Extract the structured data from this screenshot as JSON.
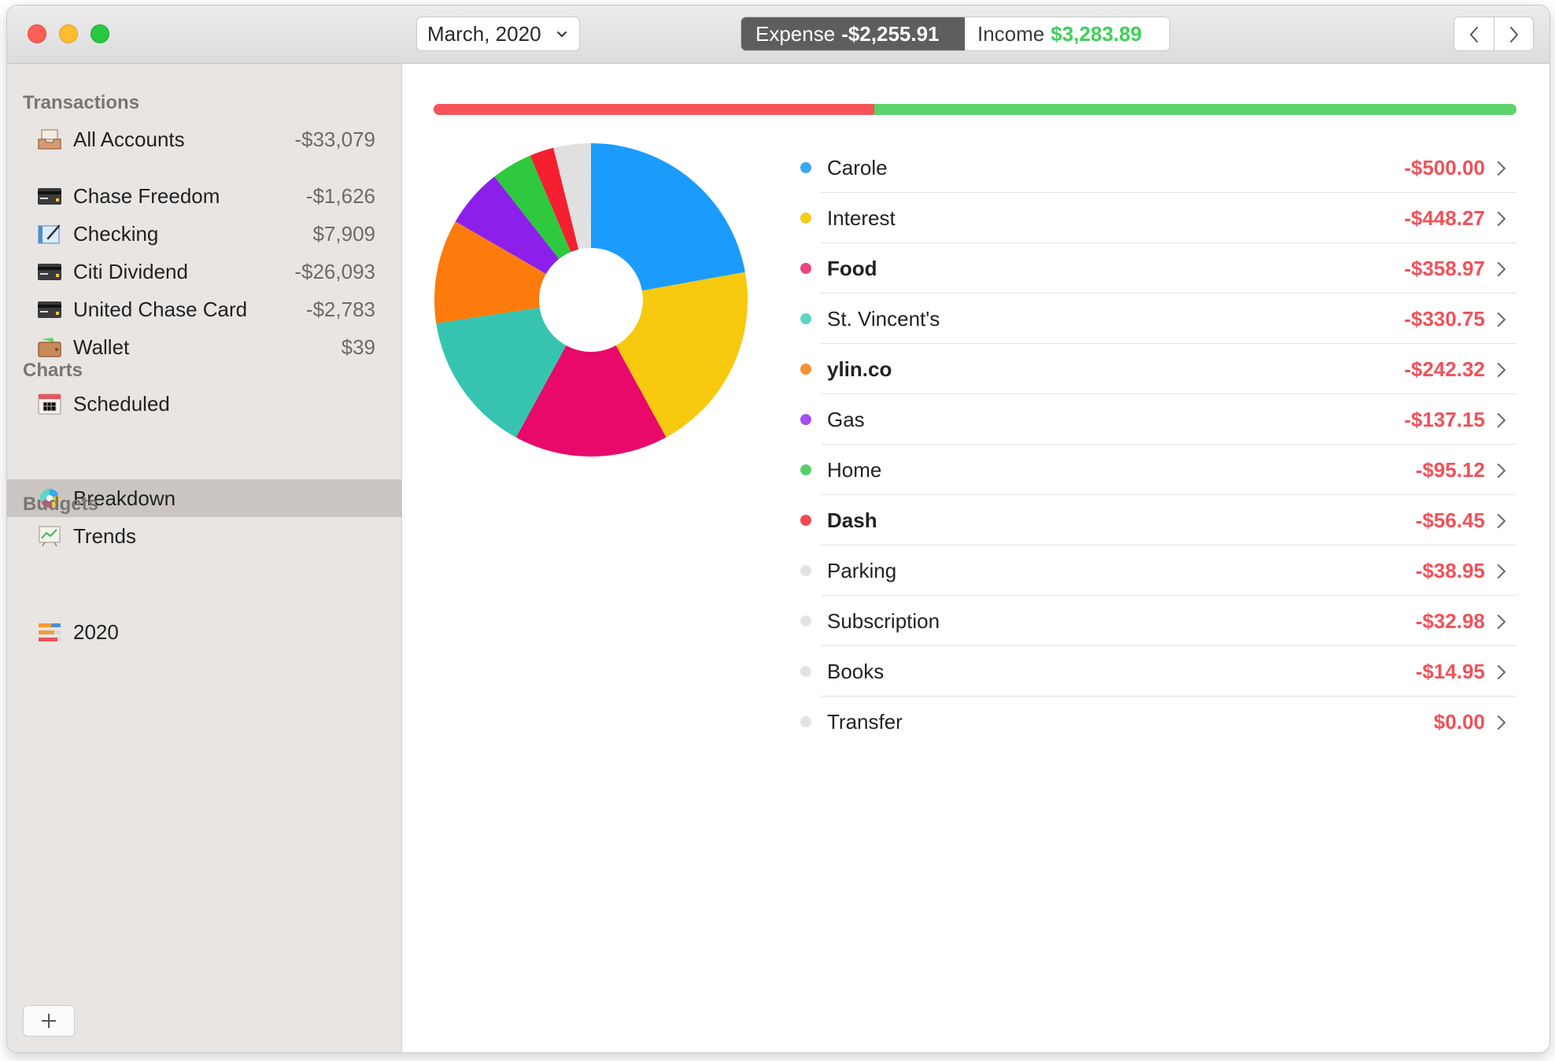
{
  "toolbar": {
    "month": "March, 2020",
    "expense_label": "Expense",
    "expense_value": "-$2,255.91",
    "income_label": "Income",
    "income_value": "$3,283.89"
  },
  "sidebar": {
    "transactions_header": "Transactions",
    "all_accounts": {
      "label": "All Accounts",
      "amount": "-$33,079",
      "icon": "inbox-tray-icon"
    },
    "accounts": [
      {
        "label": "Chase Freedom",
        "amount": "-$1,626",
        "icon": "credit-card-icon"
      },
      {
        "label": "Checking",
        "amount": "$7,909",
        "icon": "checkbook-icon"
      },
      {
        "label": "Citi Dividend",
        "amount": "-$26,093",
        "icon": "credit-card-icon"
      },
      {
        "label": "United Chase Card",
        "amount": "-$2,783",
        "icon": "credit-card-icon"
      },
      {
        "label": "Wallet",
        "amount": "$39",
        "icon": "wallet-icon"
      }
    ],
    "scheduled": {
      "label": "Scheduled",
      "icon": "calendar-icon"
    },
    "charts_header": "Charts",
    "charts": [
      {
        "label": "Breakdown",
        "icon": "pie-chart-icon",
        "selected": true
      },
      {
        "label": "Trends",
        "icon": "line-chart-icon",
        "selected": false
      }
    ],
    "budgets_header": "Budgets",
    "budgets": [
      {
        "label": "2020",
        "icon": "budget-bars-icon"
      }
    ],
    "add_icon": "plus-icon"
  },
  "colors": {
    "expense": "#f55359",
    "income": "#5ed36b",
    "selected_row": "#cbc6c3"
  },
  "ratio": {
    "expense_fraction": 0.407
  },
  "chart_data": {
    "type": "pie",
    "donut": true,
    "categories": [
      "Carole",
      "Interest",
      "Food",
      "St. Vincent's",
      "ylin.co",
      "Gas",
      "Home",
      "Dash",
      "Parking",
      "Subscription",
      "Books",
      "Transfer"
    ],
    "values": [
      500.0,
      448.27,
      358.97,
      330.75,
      242.32,
      137.15,
      95.12,
      56.45,
      38.95,
      32.98,
      14.95,
      0.0
    ],
    "display_values": [
      "-$500.00",
      "-$448.27",
      "-$358.97",
      "-$330.75",
      "-$242.32",
      "-$137.15",
      "-$95.12",
      "-$56.45",
      "-$38.95",
      "-$32.98",
      "-$14.95",
      "$0.00"
    ],
    "slice_colors": [
      "#1b9cfc",
      "#f7c90f",
      "#e8096a",
      "#36c4b0",
      "#fd7a0d",
      "#8c20ea",
      "#2ec93e",
      "#f51f2f",
      "#e0e0e0",
      "#e0e0e0",
      "#e0e0e0",
      "#e0e0e0"
    ],
    "legend_colors": [
      "#3aa6f5",
      "#f5cd1d",
      "#e94584",
      "#5fd3c4",
      "#f69136",
      "#a44ef2",
      "#55d16b",
      "#ef4a53",
      "#e3e3e3",
      "#e3e3e3",
      "#e3e3e3",
      "#e3e3e3"
    ],
    "bold": [
      false,
      false,
      true,
      false,
      true,
      false,
      false,
      true,
      false,
      false,
      false,
      false
    ]
  }
}
